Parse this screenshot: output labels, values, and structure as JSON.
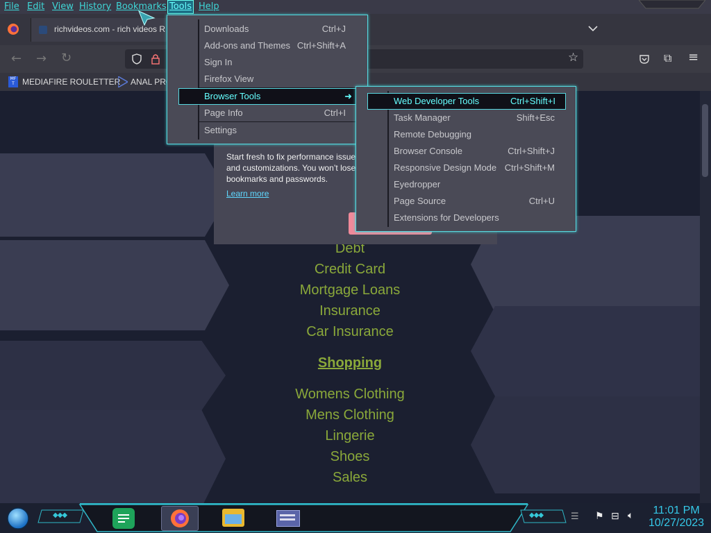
{
  "menubar": {
    "items": [
      "File",
      "Edit",
      "View",
      "History",
      "Bookmarks",
      "Tools",
      "Help"
    ],
    "active": "Tools"
  },
  "tab": {
    "title": "richvideos.com - rich videos R",
    "list_icon": "chevron-down-icon"
  },
  "bookmarks": [
    {
      "label": "MEDIAFIRE ROULETTER",
      "icon": "mediafire-icon"
    },
    {
      "label": "ANAL PRO",
      "icon": "bookmark-icon"
    }
  ],
  "tools_menu": {
    "items": [
      {
        "label": "Downloads",
        "accel": "D",
        "shortcut": "Ctrl+J"
      },
      {
        "label": "Add-ons and Themes",
        "accel": "A",
        "shortcut": "Ctrl+Shift+A"
      },
      {
        "label": "Sign In",
        "accel": "",
        "shortcut": ""
      },
      {
        "label": "Firefox View",
        "accel": "F",
        "shortcut": ""
      },
      {
        "label": "Browser Tools",
        "accel": "B",
        "shortcut": "",
        "submenu": true
      },
      {
        "label": "Page Info",
        "accel": "I",
        "shortcut": "Ctrl+I"
      },
      {
        "label": "Settings",
        "accel": "S",
        "shortcut": ""
      }
    ]
  },
  "browser_tools_menu": {
    "items": [
      {
        "label": "Web Developer Tools",
        "shortcut": "Ctrl+Shift+I"
      },
      {
        "label": "Task Manager",
        "shortcut": "Shift+Esc"
      },
      {
        "label": "Remote Debugging",
        "shortcut": ""
      },
      {
        "label": "Browser Console",
        "shortcut": "Ctrl+Shift+J"
      },
      {
        "label": "Responsive Design Mode",
        "shortcut": "Ctrl+Shift+M"
      },
      {
        "label": "Eyedropper",
        "shortcut": ""
      },
      {
        "label": "Page Source",
        "shortcut": "Ctrl+U"
      },
      {
        "label": "Extensions for Developers",
        "shortcut": ""
      }
    ]
  },
  "popup": {
    "text": "Start fresh to fix performance issues and customizations. You won’t lose bookmarks and passwords.",
    "link": "Learn more"
  },
  "page": {
    "links_top": [
      "Debt",
      "Credit Card",
      "Mortgage Loans",
      "Insurance",
      "Car Insurance"
    ],
    "heading": "Shopping",
    "links_bottom": [
      "Womens Clothing",
      "Mens Clothing",
      "Lingerie",
      "Shoes",
      "Sales"
    ]
  },
  "taskbar": {
    "time": "11:01 PM",
    "date": "10/27/2023"
  },
  "colors": {
    "accent": "#58d8e0",
    "link": "#8aa83a",
    "menu_text": "#3fd6d6"
  }
}
